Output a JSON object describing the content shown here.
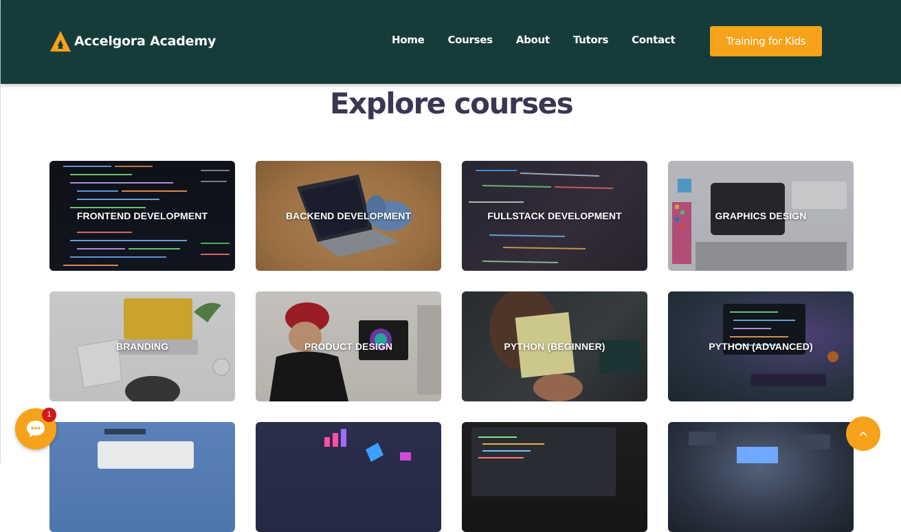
{
  "brand": {
    "name": "Accelgora Academy",
    "logo_icon": "a-logo-icon",
    "accent": "#f7a21b",
    "header_bg": "#153b3a"
  },
  "nav": {
    "items": [
      "Home",
      "Courses",
      "About",
      "Tutors",
      "Contact"
    ],
    "cta": "Training for Kids"
  },
  "main": {
    "title": "Explore courses"
  },
  "courses": [
    {
      "label": "FRONTEND DEVELOPMENT",
      "image": "code-editor-photo"
    },
    {
      "label": "BACKEND DEVELOPMENT",
      "image": "laptop-php-elephant-photo"
    },
    {
      "label": "FULLSTACK DEVELOPMENT",
      "image": "code-screen-photo"
    },
    {
      "label": "GRAPHICS DESIGN",
      "image": "drawing-tablet-photo"
    },
    {
      "label": "BRANDING",
      "image": "desk-laptop-notebook-photo"
    },
    {
      "label": "PRODUCT DESIGN",
      "image": "designer-monitor-photo"
    },
    {
      "label": "PYTHON (BEGINNER)",
      "image": "python-sticky-note-photo"
    },
    {
      "label": "PYTHON (ADVANCED)",
      "image": "computer-code-neon-photo"
    },
    {
      "label": "",
      "image": "desk-monitor-photo"
    },
    {
      "label": "",
      "image": "data-charts-3d-photo"
    },
    {
      "label": "",
      "image": "laptop-code-dark-photo"
    },
    {
      "label": "",
      "image": "circuit-chip-photo"
    }
  ],
  "widgets": {
    "chat_badge": "1",
    "chat_icon": "chat-bubble-icon",
    "scroll_icon": "arrow-up-icon"
  }
}
